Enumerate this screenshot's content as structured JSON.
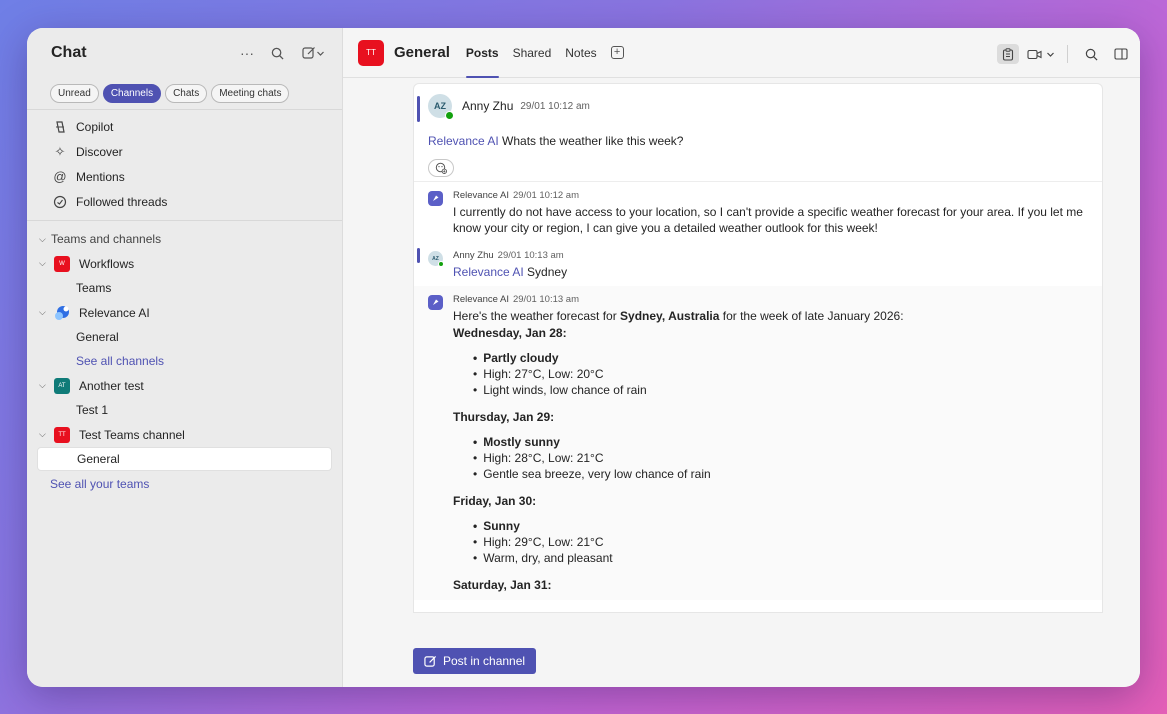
{
  "sidebar": {
    "title": "Chat",
    "filters": [
      {
        "label": "Unread",
        "active": false
      },
      {
        "label": "Channels",
        "active": true
      },
      {
        "label": "Chats",
        "active": false
      },
      {
        "label": "Meeting chats",
        "active": false
      }
    ],
    "nav": [
      {
        "label": "Copilot",
        "icon": "copilot-icon"
      },
      {
        "label": "Discover",
        "icon": "sparkle-icon"
      },
      {
        "label": "Mentions",
        "icon": "at-icon"
      },
      {
        "label": "Followed threads",
        "icon": "threads-icon"
      }
    ],
    "section_label": "Teams and channels",
    "teams": [
      {
        "name": "Workflows",
        "avatar": "W",
        "color": "#e8101f",
        "channels": [
          {
            "name": "Teams",
            "link": false
          }
        ]
      },
      {
        "name": "Relevance AI",
        "avatar": "",
        "color": "#2f6fe4",
        "channels": [
          {
            "name": "General",
            "link": false
          },
          {
            "name": "See all channels",
            "link": true
          }
        ]
      },
      {
        "name": "Another test",
        "avatar": "AT",
        "color": "#0f7b78",
        "channels": [
          {
            "name": "Test 1",
            "link": false
          }
        ]
      },
      {
        "name": "Test Teams channel",
        "avatar": "TT",
        "color": "#e8101f",
        "channels": [
          {
            "name": "General",
            "link": false,
            "selected": true
          }
        ]
      }
    ],
    "see_all_teams": "See all your teams"
  },
  "header": {
    "avatar": "TT",
    "channel_name": "General",
    "tabs": [
      {
        "label": "Posts",
        "active": true
      },
      {
        "label": "Shared",
        "active": false
      },
      {
        "label": "Notes",
        "active": false
      }
    ]
  },
  "post": {
    "avatar": "AZ",
    "author": "Anny Zhu",
    "time": "29/01 10:12 am",
    "mention": "Relevance AI",
    "text": " Whats the weather like this week?"
  },
  "replies": {
    "r1": {
      "author": "Relevance AI",
      "time": "29/01 10:12 am",
      "text": "I currently do not have access to your location, so I can't provide a specific weather forecast for your area. If you let me know your city or region, I can give you a detailed weather outlook for this week!"
    },
    "r2": {
      "avatar": "AZ",
      "author": "Anny Zhu",
      "time": "29/01 10:13 am",
      "mention": "Relevance AI",
      "text": " Sydney"
    },
    "r3": {
      "author": "Relevance AI",
      "time": "29/01 10:13 am",
      "intro_before": "Here's the weather forecast for ",
      "intro_bold": "Sydney, Australia",
      "intro_after": " for the week of late January 2026:",
      "days": [
        {
          "day": "Wednesday, Jan 28:",
          "items": [
            "Partly cloudy",
            "High: 27°C, Low: 20°C",
            "Light winds, low chance of rain"
          ]
        },
        {
          "day": "Thursday, Jan 29:",
          "items": [
            "Mostly sunny",
            "High: 28°C, Low: 21°C",
            "Gentle sea breeze, very low chance of rain"
          ]
        },
        {
          "day": "Friday, Jan 30:",
          "items": [
            "Sunny",
            "High: 29°C, Low: 21°C",
            "Warm, dry, and pleasant"
          ]
        }
      ],
      "last_day": "Saturday, Jan 31:"
    }
  },
  "compose": {
    "label": "Post in channel"
  }
}
